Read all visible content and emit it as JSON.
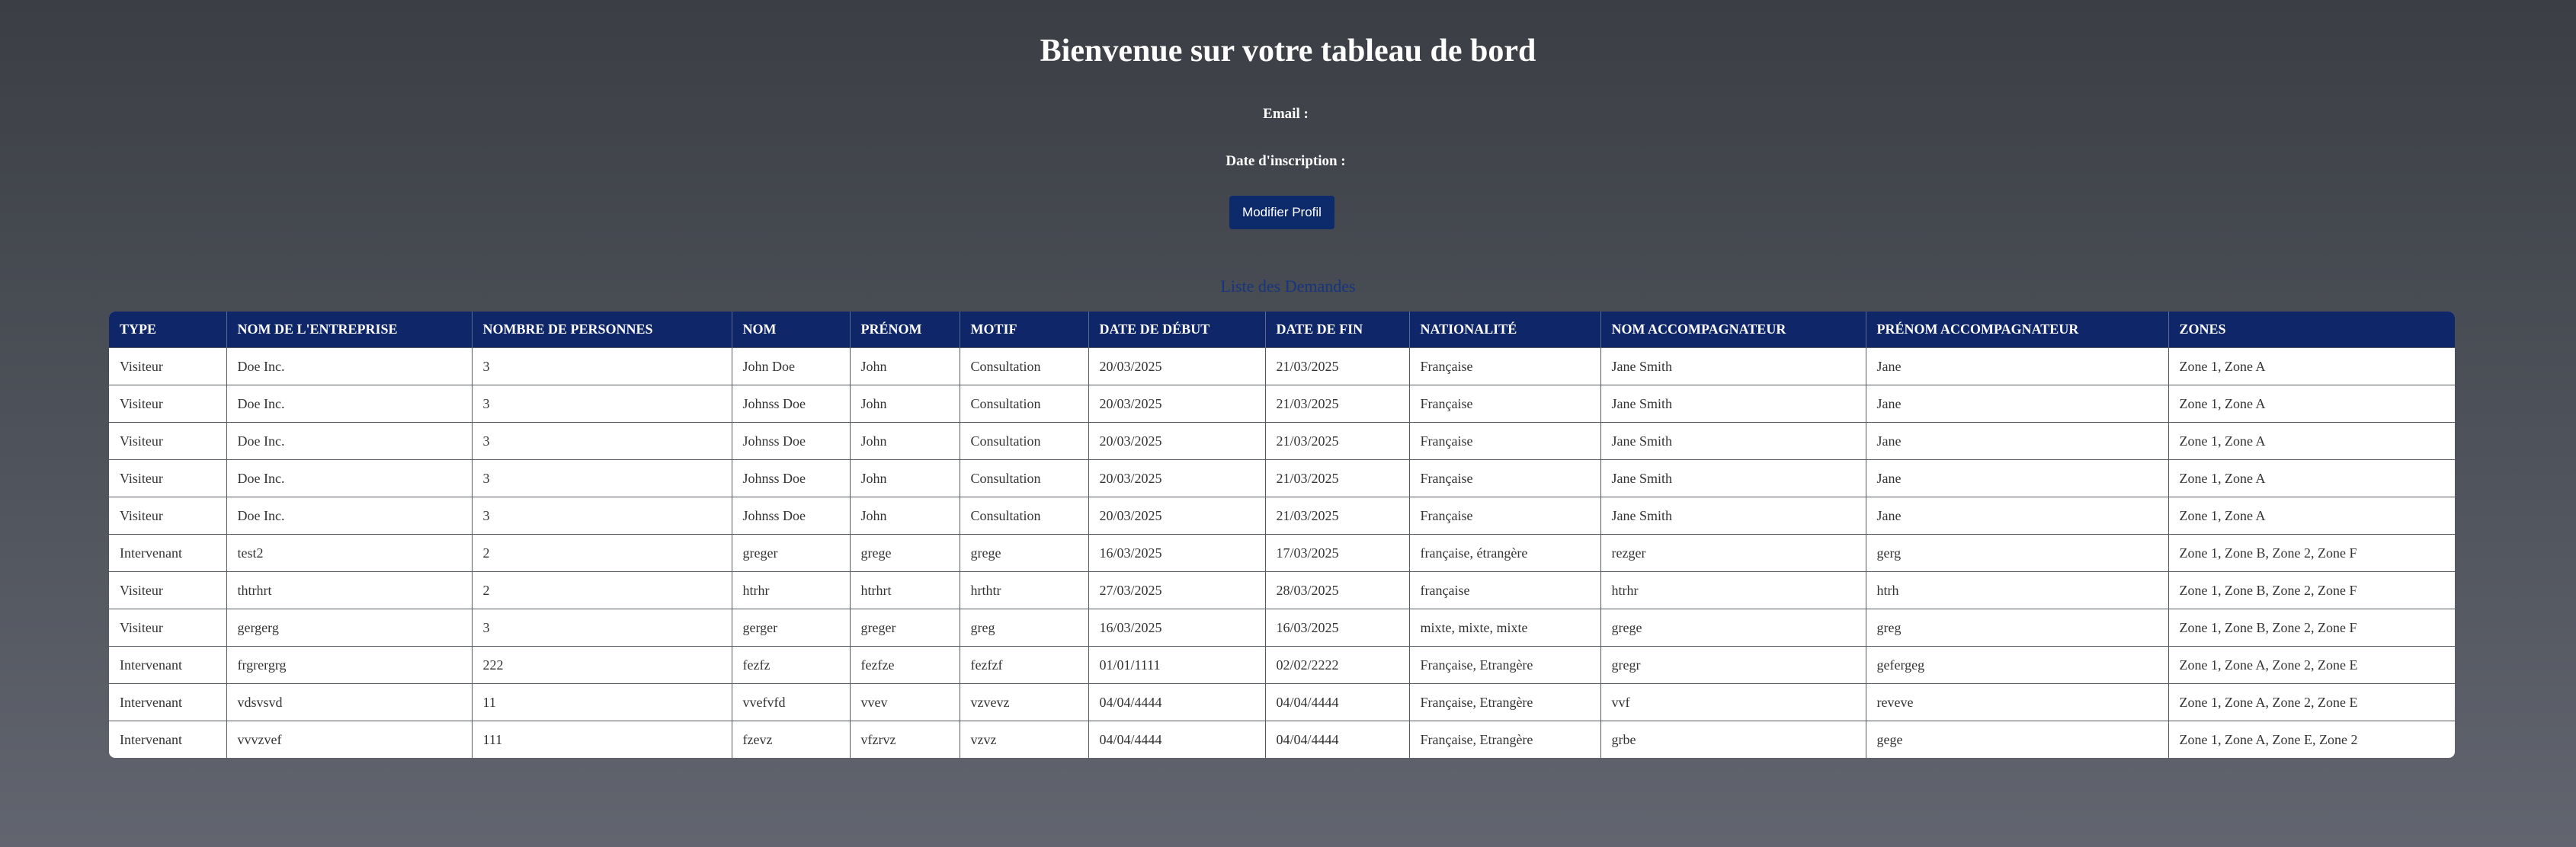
{
  "header": {
    "title": "Bienvenue sur votre tableau de bord",
    "email_label": "Email :",
    "email_value": "",
    "date_label": "Date d'inscription :",
    "date_value": "",
    "edit_button_label": "Modifier Profil"
  },
  "requests": {
    "title": "Liste des Demandes",
    "columns": [
      "TYPE",
      "NOM DE L'ENTREPRISE",
      "NOMBRE DE PERSONNES",
      "NOM",
      "PRÉNOM",
      "MOTIF",
      "DATE DE DÉBUT",
      "DATE DE FIN",
      "NATIONALITÉ",
      "NOM ACCOMPAGNATEUR",
      "PRÉNOM ACCOMPAGNATEUR",
      "ZONES"
    ],
    "rows": [
      [
        "Visiteur",
        "Doe Inc.",
        "3",
        "John Doe",
        "John",
        "Consultation",
        "20/03/2025",
        "21/03/2025",
        "Française",
        "Jane Smith",
        "Jane",
        "Zone 1, Zone A"
      ],
      [
        "Visiteur",
        "Doe Inc.",
        "3",
        "Johnss Doe",
        "John",
        "Consultation",
        "20/03/2025",
        "21/03/2025",
        "Française",
        "Jane Smith",
        "Jane",
        "Zone 1, Zone A"
      ],
      [
        "Visiteur",
        "Doe Inc.",
        "3",
        "Johnss Doe",
        "John",
        "Consultation",
        "20/03/2025",
        "21/03/2025",
        "Française",
        "Jane Smith",
        "Jane",
        "Zone 1, Zone A"
      ],
      [
        "Visiteur",
        "Doe Inc.",
        "3",
        "Johnss Doe",
        "John",
        "Consultation",
        "20/03/2025",
        "21/03/2025",
        "Française",
        "Jane Smith",
        "Jane",
        "Zone 1, Zone A"
      ],
      [
        "Visiteur",
        "Doe Inc.",
        "3",
        "Johnss Doe",
        "John",
        "Consultation",
        "20/03/2025",
        "21/03/2025",
        "Française",
        "Jane Smith",
        "Jane",
        "Zone 1, Zone A"
      ],
      [
        "Intervenant",
        "test2",
        "2",
        "greger",
        "grege",
        "grege",
        "16/03/2025",
        "17/03/2025",
        "française, étrangère",
        "rezger",
        "gerg",
        "Zone 1, Zone B, Zone 2, Zone F"
      ],
      [
        "Visiteur",
        "thtrhrt",
        "2",
        "htrhr",
        "htrhrt",
        "hrthtr",
        "27/03/2025",
        "28/03/2025",
        "française",
        "htrhr",
        "htrh",
        "Zone 1, Zone B, Zone 2, Zone F"
      ],
      [
        "Visiteur",
        "gergerg",
        "3",
        "gerger",
        "greger",
        "greg",
        "16/03/2025",
        "16/03/2025",
        "mixte, mixte, mixte",
        "grege",
        "greg",
        "Zone 1, Zone B, Zone 2, Zone F"
      ],
      [
        "Intervenant",
        "frgrergrg",
        "222",
        "fezfz",
        "fezfze",
        "fezfzf",
        "01/01/1111",
        "02/02/2222",
        "Française, Etrangère",
        "gregr",
        "gefergeg",
        "Zone 1, Zone A, Zone 2, Zone E"
      ],
      [
        "Intervenant",
        "vdsvsvd",
        "11",
        "vvefvfd",
        "vvev",
        "vzvevz",
        "04/04/4444",
        "04/04/4444",
        "Française, Etrangère",
        "vvf",
        "reveve",
        "Zone 1, Zone A, Zone 2, Zone E"
      ],
      [
        "Intervenant",
        "vvvzvef",
        "111",
        "fzevz",
        "vfzrvz",
        "vzvz",
        "04/04/4444",
        "04/04/4444",
        "Française, Etrangère",
        "grbe",
        "gege",
        "Zone 1, Zone A, Zone E, Zone 2"
      ]
    ]
  },
  "colors": {
    "table_header": "#0f2769",
    "button": "#0d2a6b",
    "list_title": "#16357f"
  }
}
